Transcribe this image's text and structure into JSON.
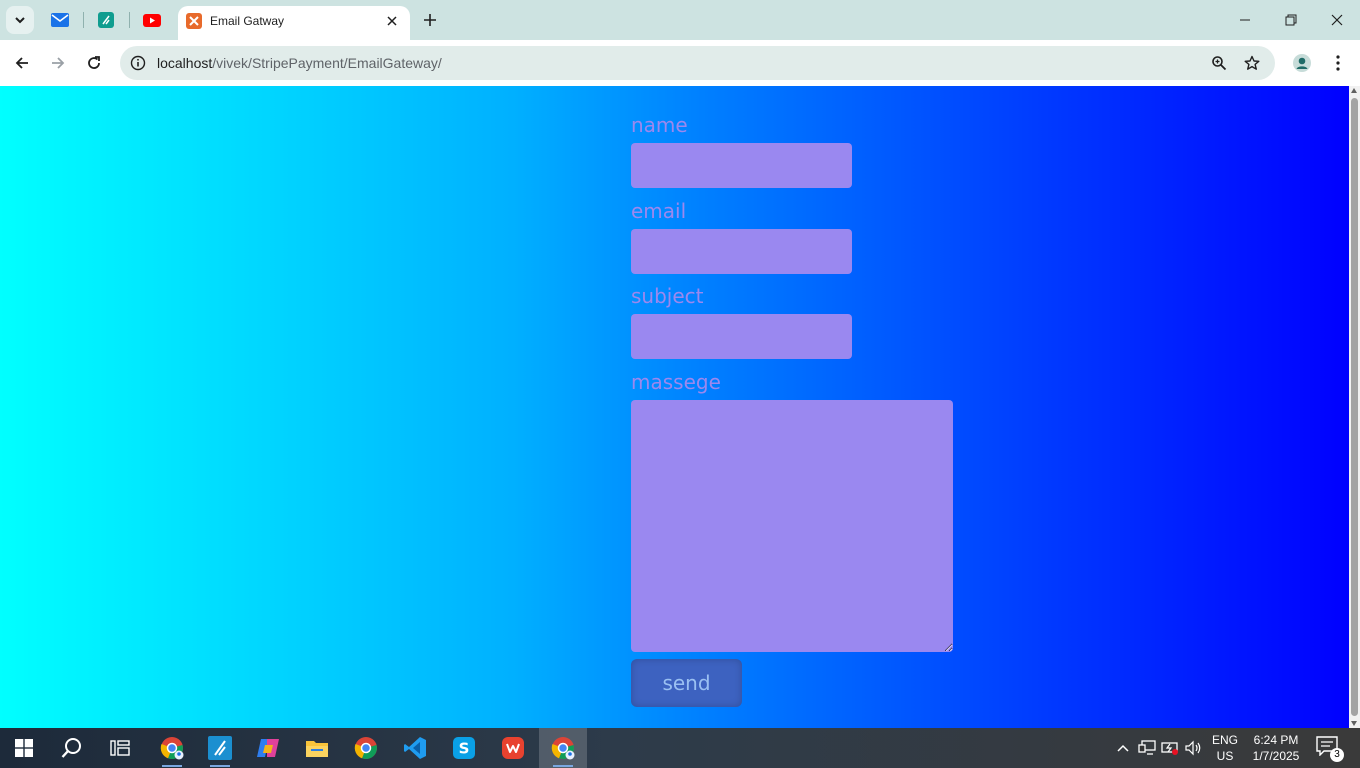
{
  "browser": {
    "tabs": {
      "active_title": "Email Gatway"
    },
    "url": {
      "host": "localhost",
      "path": "/vivek/StripePayment/EmailGateway/"
    },
    "icons": [
      "tab-search-icon",
      "mail-icon",
      "app-icon",
      "youtube-icon",
      "xampp-icon",
      "close-icon",
      "plus-icon",
      "minimize-icon",
      "restore-icon",
      "window-close-icon",
      "back-icon",
      "forward-icon",
      "reload-icon",
      "info-icon",
      "zoom-icon",
      "star-icon",
      "profile-icon",
      "menu-icon"
    ]
  },
  "form": {
    "name_label": "name",
    "email_label": "email",
    "subject_label": "subject",
    "message_label": "massege",
    "name_value": "",
    "email_value": "",
    "subject_value": "",
    "message_value": "",
    "send_label": "send"
  },
  "colors": {
    "gradient_start": "#00ffff",
    "gradient_end": "#0000ff",
    "field_bg": "#9a88f0",
    "label_color": "#9c88ee",
    "button_bg": "#3d62c0"
  },
  "taskbar": {
    "apps": [
      "start-icon",
      "search-icon",
      "task-view-icon",
      "chrome-profile-icon",
      "app-icon",
      "copilot-icon",
      "file-explorer-icon",
      "chrome-icon",
      "vscode-icon",
      "skype-icon",
      "wps-icon",
      "chrome-active-icon"
    ],
    "lang_line1": "ENG",
    "lang_line2": "US",
    "time": "6:24 PM",
    "date": "1/7/2025",
    "notification_count": "3"
  }
}
